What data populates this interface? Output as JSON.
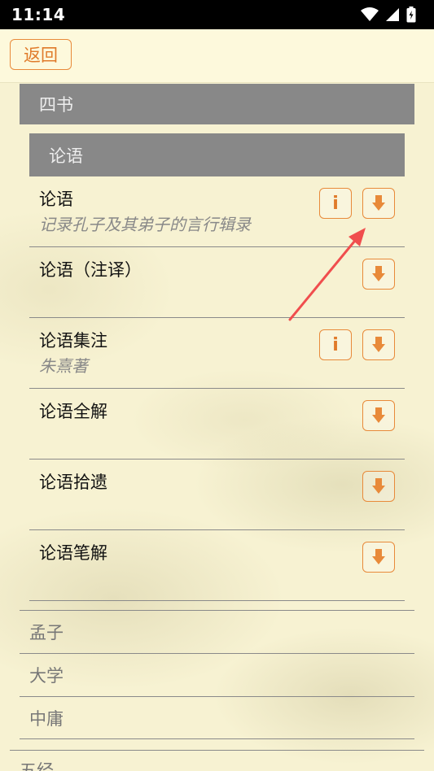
{
  "status": {
    "time": "11:14"
  },
  "nav": {
    "back_label": "返回"
  },
  "section": {
    "title": "四书"
  },
  "subsection": {
    "title": "论语"
  },
  "books": [
    {
      "title": "论语",
      "subtitle": "记录孔子及其弟子的言行辑录",
      "has_info": true
    },
    {
      "title": "论语（注译）",
      "subtitle": "",
      "has_info": false
    },
    {
      "title": "论语集注",
      "subtitle": "朱熹著",
      "has_info": true
    },
    {
      "title": "论语全解",
      "subtitle": "",
      "has_info": false
    },
    {
      "title": "论语拾遗",
      "subtitle": "",
      "has_info": false
    },
    {
      "title": "论语笔解",
      "subtitle": "",
      "has_info": false
    }
  ],
  "info_icon_label": "i",
  "categories": [
    "孟子",
    "大学",
    "中庸"
  ],
  "next_category": "五经",
  "colors": {
    "accent": "#e88a3a",
    "header_bg": "#888888",
    "arrow": "#f04e4e"
  },
  "icons": {
    "info": "info-icon",
    "download": "download-arrow-icon"
  }
}
